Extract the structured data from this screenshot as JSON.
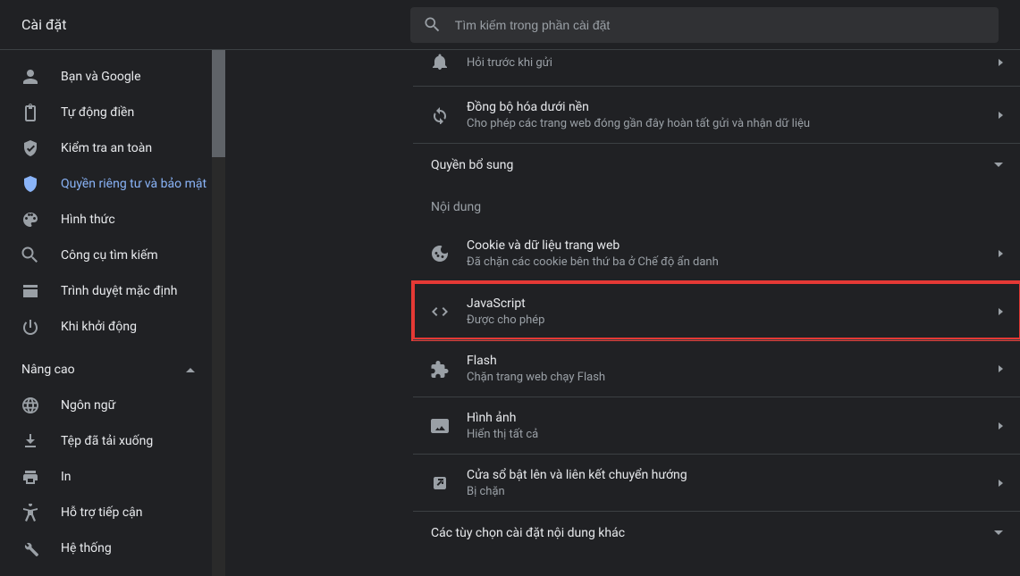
{
  "header": {
    "title": "Cài đặt",
    "search_placeholder": "Tìm kiếm trong phần cài đặt"
  },
  "sidebar": {
    "items": [
      {
        "icon": "person",
        "label": "Bạn và Google"
      },
      {
        "icon": "clipboard",
        "label": "Tự động điền"
      },
      {
        "icon": "shield-check",
        "label": "Kiểm tra an toàn"
      },
      {
        "icon": "shield",
        "label": "Quyền riêng tư và bảo mật",
        "active": true
      },
      {
        "icon": "palette",
        "label": "Hình thức"
      },
      {
        "icon": "search",
        "label": "Công cụ tìm kiếm"
      },
      {
        "icon": "browser",
        "label": "Trình duyệt mặc định"
      },
      {
        "icon": "power",
        "label": "Khi khởi động"
      }
    ],
    "advanced_label": "Nâng cao",
    "advanced_items": [
      {
        "icon": "globe",
        "label": "Ngôn ngữ"
      },
      {
        "icon": "download",
        "label": "Tệp đã tải xuống"
      },
      {
        "icon": "printer",
        "label": "In"
      },
      {
        "icon": "accessibility",
        "label": "Hỗ trợ tiếp cận"
      },
      {
        "icon": "wrench",
        "label": "Hệ thống"
      }
    ]
  },
  "main": {
    "top_rows": [
      {
        "icon": "bell",
        "subtitle": "Hỏi trước khi gửi"
      },
      {
        "icon": "sync",
        "title": "Đồng bộ hóa dưới nền",
        "subtitle": "Cho phép các trang web đóng gần đây hoàn tất gửi và nhận dữ liệu"
      }
    ],
    "extra_perms_label": "Quyền bổ sung",
    "content_label": "Nội dung",
    "content_rows": [
      {
        "icon": "cookie",
        "title": "Cookie và dữ liệu trang web",
        "subtitle": "Đã chặn các cookie bên thứ ba ở Chế độ ẩn danh"
      },
      {
        "icon": "code",
        "title": "JavaScript",
        "subtitle": "Được cho phép",
        "highlighted": true
      },
      {
        "icon": "puzzle",
        "title": "Flash",
        "subtitle": "Chặn trang web chạy Flash"
      },
      {
        "icon": "image",
        "title": "Hình ảnh",
        "subtitle": "Hiển thị tất cả"
      },
      {
        "icon": "popup",
        "title": "Cửa sổ bật lên và liên kết chuyển hướng",
        "subtitle": "Bị chặn"
      }
    ],
    "other_options_label": "Các tùy chọn cài đặt nội dung khác"
  }
}
